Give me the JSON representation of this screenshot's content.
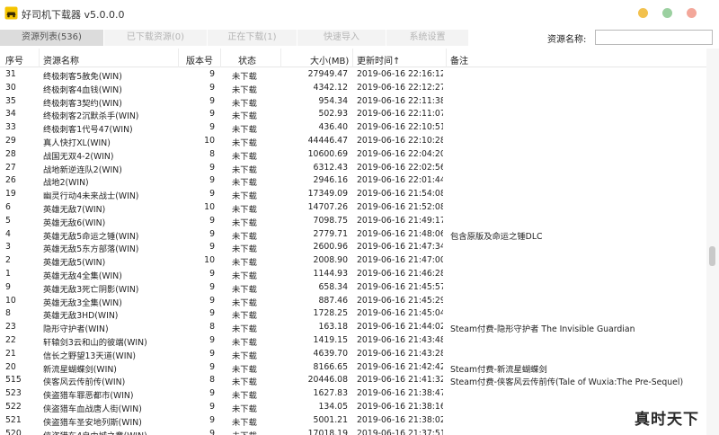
{
  "window": {
    "title": "好司机下载器 v5.0.0.0"
  },
  "tabs": [
    {
      "label": "资源列表(536)",
      "active": true
    },
    {
      "label": "已下载资源(0)",
      "active": false
    },
    {
      "label": "正在下载(1)",
      "active": false
    },
    {
      "label": "快速导入",
      "active": false
    },
    {
      "label": "系统设置",
      "active": false
    }
  ],
  "search": {
    "label": "资源名称:",
    "value": ""
  },
  "columns": {
    "id": "序号",
    "name": "资源名称",
    "version": "版本号",
    "status": "状态",
    "size": "大小(MB)",
    "updated": "更新时间↑",
    "note": "备注"
  },
  "rows": [
    {
      "id": "31",
      "name": "终极刺客5赦免(WIN)",
      "version": "9",
      "status": "未下载",
      "size": "27949.47",
      "updated": "2019-06-16  22:16:12",
      "note": ""
    },
    {
      "id": "30",
      "name": "终极刺客4血钱(WIN)",
      "version": "9",
      "status": "未下载",
      "size": "4342.12",
      "updated": "2019-06-16  22:12:27",
      "note": ""
    },
    {
      "id": "35",
      "name": "终极刺客3契约(WIN)",
      "version": "9",
      "status": "未下载",
      "size": "954.34",
      "updated": "2019-06-16  22:11:38",
      "note": ""
    },
    {
      "id": "34",
      "name": "终极刺客2沉默杀手(WIN)",
      "version": "9",
      "status": "未下载",
      "size": "502.93",
      "updated": "2019-06-16  22:11:07",
      "note": ""
    },
    {
      "id": "33",
      "name": "终极刺客1代号47(WIN)",
      "version": "9",
      "status": "未下载",
      "size": "436.40",
      "updated": "2019-06-16  22:10:51",
      "note": ""
    },
    {
      "id": "29",
      "name": "真人快打XL(WIN)",
      "version": "10",
      "status": "未下载",
      "size": "44446.47",
      "updated": "2019-06-16  22:10:28",
      "note": ""
    },
    {
      "id": "28",
      "name": "战国无双4-2(WIN)",
      "version": "8",
      "status": "未下载",
      "size": "10600.69",
      "updated": "2019-06-16  22:04:20",
      "note": ""
    },
    {
      "id": "27",
      "name": "战地新逆连队2(WIN)",
      "version": "9",
      "status": "未下载",
      "size": "6312.43",
      "updated": "2019-06-16  22:02:56",
      "note": ""
    },
    {
      "id": "26",
      "name": "战地2(WIN)",
      "version": "9",
      "status": "未下载",
      "size": "2946.16",
      "updated": "2019-06-16  22:01:44",
      "note": ""
    },
    {
      "id": "19",
      "name": "幽灵行动4未来战士(WIN)",
      "version": "9",
      "status": "未下载",
      "size": "17349.09",
      "updated": "2019-06-16  21:54:08",
      "note": ""
    },
    {
      "id": "6",
      "name": "英雄无敌7(WIN)",
      "version": "10",
      "status": "未下载",
      "size": "14707.26",
      "updated": "2019-06-16  21:52:08",
      "note": ""
    },
    {
      "id": "5",
      "name": "英雄无敌6(WIN)",
      "version": "9",
      "status": "未下载",
      "size": "7098.75",
      "updated": "2019-06-16  21:49:17",
      "note": ""
    },
    {
      "id": "4",
      "name": "英雄无敌5命运之锤(WIN)",
      "version": "9",
      "status": "未下载",
      "size": "2779.71",
      "updated": "2019-06-16  21:48:06",
      "note": "包含原版及命运之锤DLC"
    },
    {
      "id": "3",
      "name": "英雄无敌5东方部落(WIN)",
      "version": "9",
      "status": "未下载",
      "size": "2600.96",
      "updated": "2019-06-16  21:47:34",
      "note": ""
    },
    {
      "id": "2",
      "name": "英雄无敌5(WIN)",
      "version": "10",
      "status": "未下载",
      "size": "2008.90",
      "updated": "2019-06-16  21:47:00",
      "note": ""
    },
    {
      "id": "1",
      "name": "英雄无敌4全集(WIN)",
      "version": "9",
      "status": "未下载",
      "size": "1144.93",
      "updated": "2019-06-16  21:46:28",
      "note": ""
    },
    {
      "id": "9",
      "name": "英雄无敌3死亡阴影(WIN)",
      "version": "9",
      "status": "未下载",
      "size": "658.34",
      "updated": "2019-06-16  21:45:57",
      "note": ""
    },
    {
      "id": "10",
      "name": "英雄无敌3全集(WIN)",
      "version": "9",
      "status": "未下载",
      "size": "887.46",
      "updated": "2019-06-16  21:45:29",
      "note": ""
    },
    {
      "id": "8",
      "name": "英雄无敌3HD(WIN)",
      "version": "9",
      "status": "未下载",
      "size": "1728.25",
      "updated": "2019-06-16  21:45:04",
      "note": ""
    },
    {
      "id": "23",
      "name": "隐形守护者(WIN)",
      "version": "8",
      "status": "未下载",
      "size": "163.18",
      "updated": "2019-06-16  21:44:02",
      "note": "Steam付费-隐形守护者 The Invisible Guardian"
    },
    {
      "id": "22",
      "name": "轩辕剑3云和山的彼端(WIN)",
      "version": "9",
      "status": "未下载",
      "size": "1419.15",
      "updated": "2019-06-16  21:43:48",
      "note": ""
    },
    {
      "id": "21",
      "name": "信长之野望13天道(WIN)",
      "version": "9",
      "status": "未下载",
      "size": "4639.70",
      "updated": "2019-06-16  21:43:28",
      "note": ""
    },
    {
      "id": "20",
      "name": "新流星蝴蝶剑(WIN)",
      "version": "9",
      "status": "未下载",
      "size": "8166.65",
      "updated": "2019-06-16  21:42:42",
      "note": "Steam付费-新流星蝴蝶剑"
    },
    {
      "id": "515",
      "name": "侠客风云传前传(WIN)",
      "version": "8",
      "status": "未下载",
      "size": "20446.08",
      "updated": "2019-06-16  21:41:32",
      "note": "Steam付费-侠客风云传前传(Tale of Wuxia:The Pre-Sequel)"
    },
    {
      "id": "523",
      "name": "侠盗猎车罪恶都市(WIN)",
      "version": "9",
      "status": "未下载",
      "size": "1627.83",
      "updated": "2019-06-16  21:38:47",
      "note": ""
    },
    {
      "id": "522",
      "name": "侠盗猎车血战唐人街(WIN)",
      "version": "9",
      "status": "未下载",
      "size": "134.05",
      "updated": "2019-06-16  21:38:16",
      "note": ""
    },
    {
      "id": "521",
      "name": "侠盗猎车圣安地列斯(WIN)",
      "version": "9",
      "status": "未下载",
      "size": "5001.21",
      "updated": "2019-06-16  21:38:02",
      "note": ""
    },
    {
      "id": "520",
      "name": "侠盗猎车4自由城之章(WIN)",
      "version": "9",
      "status": "未下载",
      "size": "17018.19",
      "updated": "2019-06-16  21:37:51",
      "note": ""
    }
  ],
  "watermark": "真时天下"
}
